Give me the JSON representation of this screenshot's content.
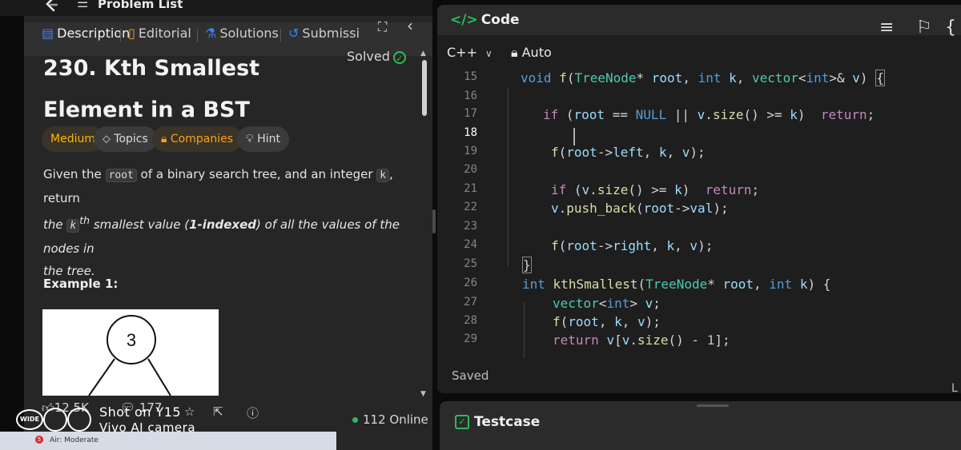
{
  "topbar": {
    "problem_list_label": "Problem List"
  },
  "tabs": [
    {
      "label": "Description",
      "icon": "document-icon"
    },
    {
      "label": "Editorial",
      "icon": "book-icon"
    },
    {
      "label": "Solutions",
      "icon": "flask-icon"
    },
    {
      "label": "Submissi",
      "icon": "history-icon"
    }
  ],
  "problem": {
    "title": "230. Kth Smallest Element in a BST",
    "status": "Solved",
    "tags": {
      "difficulty": "Medium",
      "topics": "Topics",
      "companies": "Companies",
      "hint": "Hint"
    },
    "desc": {
      "p1": "Given the ",
      "code_root": "root",
      "p2": " of a binary search tree, and an integer ",
      "code_k": "k",
      "p3": ", return",
      "p4": "the ",
      "code_kth": "k",
      "sup_th": "th",
      "p5": " smallest value (",
      "bold": "1-indexed",
      "p6": ") of all the values of the nodes in",
      "p7": "the tree."
    },
    "example_label": "Example 1:",
    "example_node_value": "3"
  },
  "footer": {
    "likes": "12.5K",
    "comments": "177",
    "online": "112 Online"
  },
  "code_panel": {
    "title": "Code",
    "language": "C++",
    "mode": "Auto",
    "saved": "Saved",
    "edge_char": "L"
  },
  "editor": {
    "current_line": 18,
    "lines": [
      {
        "n": 15,
        "t": "void f(TreeNode* root, int k, vector<int>& v) {"
      },
      {
        "n": 16,
        "t": ""
      },
      {
        "n": 17,
        "t": "    if (root == NULL || v.size() >= k)  return;"
      },
      {
        "n": 18,
        "t": ""
      },
      {
        "n": 19,
        "t": "    f(root->left, k, v);"
      },
      {
        "n": 20,
        "t": ""
      },
      {
        "n": 21,
        "t": "    if (v.size() >= k)  return;"
      },
      {
        "n": 22,
        "t": "    v.push_back(root->val);"
      },
      {
        "n": 23,
        "t": ""
      },
      {
        "n": 24,
        "t": "    f(root->right, k, v);"
      },
      {
        "n": 25,
        "t": "}"
      },
      {
        "n": 26,
        "t": "int kthSmallest(TreeNode* root, int k) {"
      },
      {
        "n": 27,
        "t": "    vector<int> v;"
      },
      {
        "n": 28,
        "t": "    f(root, k, v);"
      },
      {
        "n": 29,
        "t": "    return v[v.size() - 1];"
      }
    ]
  },
  "testcase": {
    "label": "Testcase"
  },
  "watermark": {
    "badge": "WIDE",
    "line1": "Shot on Y15",
    "line2": "Vivo AI camera"
  },
  "taskbar": {
    "air": "Air: Moderate",
    "badge": "5"
  },
  "colors": {
    "accent_green": "#2cbb5d",
    "medium": "#ffb700",
    "companies": "#ffa116"
  }
}
